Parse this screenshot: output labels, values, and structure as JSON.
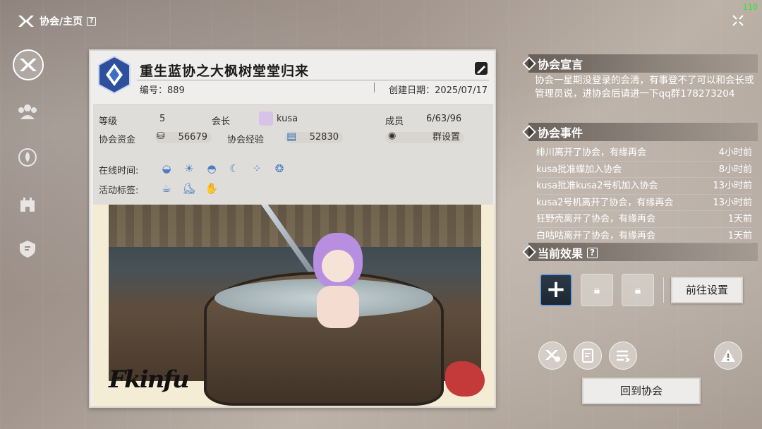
{
  "header": {
    "breadcrumb": "协会/主页",
    "help": "?",
    "fps": "110"
  },
  "guild": {
    "name": "重生蓝协之大枫树堂堂归来",
    "id_label": "编号：889",
    "created_label": "创建日期：2025/07/17",
    "level_label": "等级",
    "level_value": "5",
    "leader_label": "会长",
    "leader_value": "kusa",
    "members_label": "成员",
    "members_value": "6/63/96",
    "funds_label": "协会资金",
    "funds_value": "56679",
    "exp_label": "协会经验",
    "exp_value": "52830",
    "group_settings": "群设置",
    "online_label": "在线时间:",
    "tags_label": "活动标签:",
    "signature": "Fkinfu"
  },
  "declaration": {
    "title": "协会宣言",
    "text": "协会一星期没登录的会清，有事登不了可以和会长或管理员说，进协会后请进一下qq群178273204"
  },
  "events": {
    "title": "协会事件",
    "items": [
      {
        "text": "绯川离开了协会，有缘再会",
        "time": "4小时前"
      },
      {
        "text": "kusa批准蝶加入协会",
        "time": "8小时前"
      },
      {
        "text": "kusa批准kusa2号机加入协会",
        "time": "13小时前"
      },
      {
        "text": "kusa2号机离开了协会，有缘再会",
        "time": "13小时前"
      },
      {
        "text": "狂野壳离开了协会，有缘再会",
        "time": "1天前"
      },
      {
        "text": "白咕咕离开了协会，有缘再会",
        "time": "1天前"
      }
    ]
  },
  "effects": {
    "title": "当前效果",
    "help": "?",
    "add": "+",
    "goto_settings": "前往设置"
  },
  "footer": {
    "back_button": "回到协会"
  }
}
